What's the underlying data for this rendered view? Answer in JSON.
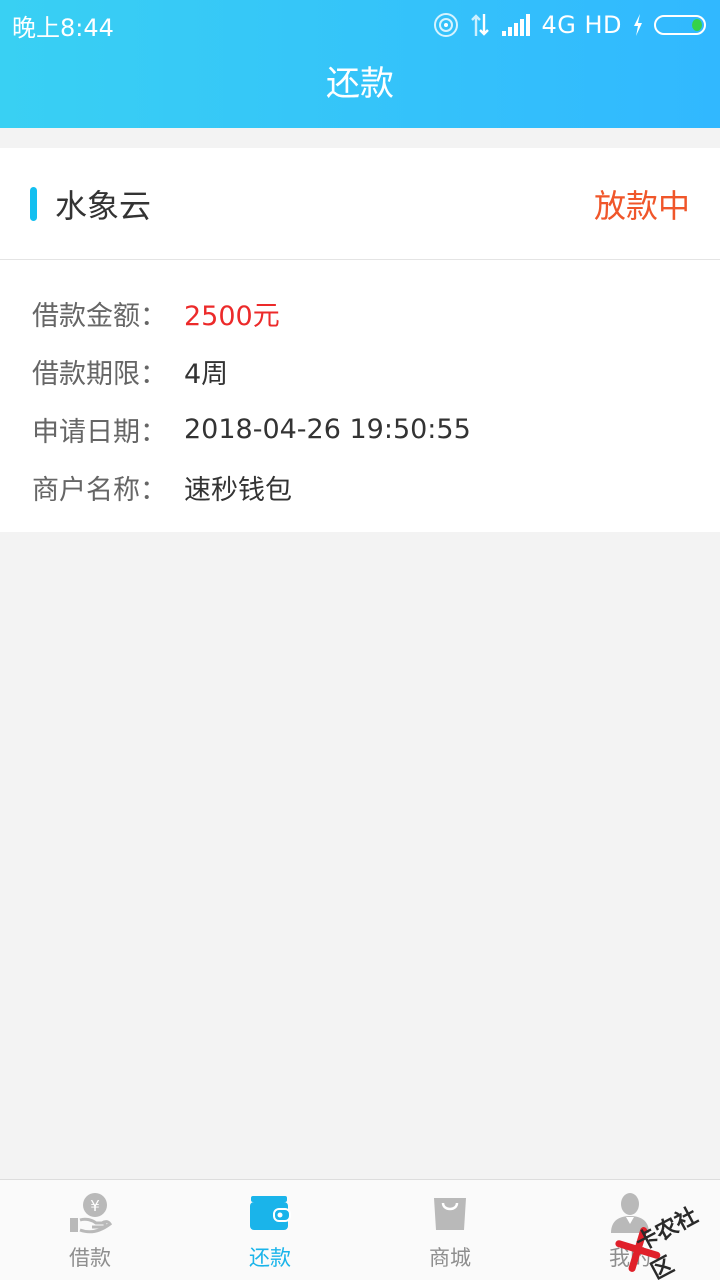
{
  "status_bar": {
    "time": "晚上8:44",
    "network": "4G HD",
    "icons": [
      "hotspot-icon",
      "data-transfer-icon",
      "signal-icon",
      "charging-icon",
      "battery-icon"
    ]
  },
  "header": {
    "title": "还款"
  },
  "loan": {
    "lender": "水象云",
    "status": "放款中",
    "rows": [
      {
        "label": "借款金额：",
        "value": "2500元"
      },
      {
        "label": "借款期限：",
        "value": "4周"
      },
      {
        "label": "申请日期：",
        "value": "2018-04-26 19:50:55"
      },
      {
        "label": "商户名称：",
        "value": "速秒钱包"
      }
    ]
  },
  "tabs": [
    {
      "label": "借款",
      "icon": "loan-icon",
      "active": false
    },
    {
      "label": "还款",
      "icon": "wallet-icon",
      "active": true
    },
    {
      "label": "商城",
      "icon": "shopping-bag-icon",
      "active": false
    },
    {
      "label": "我的",
      "icon": "user-icon",
      "active": false
    }
  ],
  "watermark": {
    "text": "卡农社区"
  },
  "colors": {
    "header_gradient_start": "#39d0f3",
    "header_gradient_end": "#31b8ff",
    "accent": "#13bff0",
    "status": "#f0562a",
    "amount": "#ec2a2a",
    "tab_active": "#1ab4ea",
    "tab_inactive": "#8e8e8e"
  }
}
